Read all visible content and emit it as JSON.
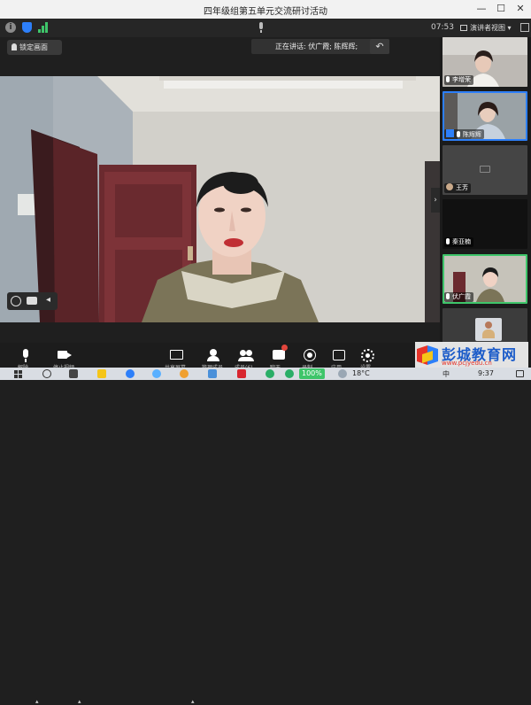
{
  "window": {
    "title": "四年级组第五单元交流研讨活动",
    "minimize": "—",
    "maximize": "☐",
    "close": "✕"
  },
  "toolbar": {
    "speaking_label": "正在讲话: 伏广霞; 陈辉辉;",
    "time": "07:53",
    "view_mode_label": "演讲者视图"
  },
  "main": {
    "pin_label": "锁定画面"
  },
  "participants": [
    {
      "name": "李增荣",
      "muted": true
    },
    {
      "name": "陈辉辉",
      "muted": false,
      "selected": true
    },
    {
      "name": "王芳",
      "camera_off": true
    },
    {
      "name": "秦亚楠",
      "muted": true
    },
    {
      "name": "伏广霞",
      "muted": true
    },
    {
      "name": "",
      "muted": false
    }
  ],
  "controls": [
    {
      "icon": "microphone-icon",
      "label": "解除"
    },
    {
      "icon": "video-camera-icon",
      "label": "停止视频"
    },
    {
      "icon": "share-screen-icon",
      "label": "共享屏幕"
    },
    {
      "icon": "manage-users-icon",
      "label": "管理成员"
    },
    {
      "icon": "participants-icon",
      "label": "成员(6)"
    },
    {
      "icon": "chat-icon",
      "label": "聊天"
    },
    {
      "icon": "record-icon",
      "label": "录制"
    },
    {
      "icon": "apps-icon",
      "label": "应用"
    },
    {
      "icon": "settings-icon",
      "label": "设置"
    }
  ],
  "taskbar": {
    "battery": "100%",
    "temperature": "18°C",
    "clock_time": "9:37",
    "input_method": "中"
  },
  "watermark": {
    "brand_text": "彭城教育网",
    "url": "www.pcjyedu.cn"
  }
}
